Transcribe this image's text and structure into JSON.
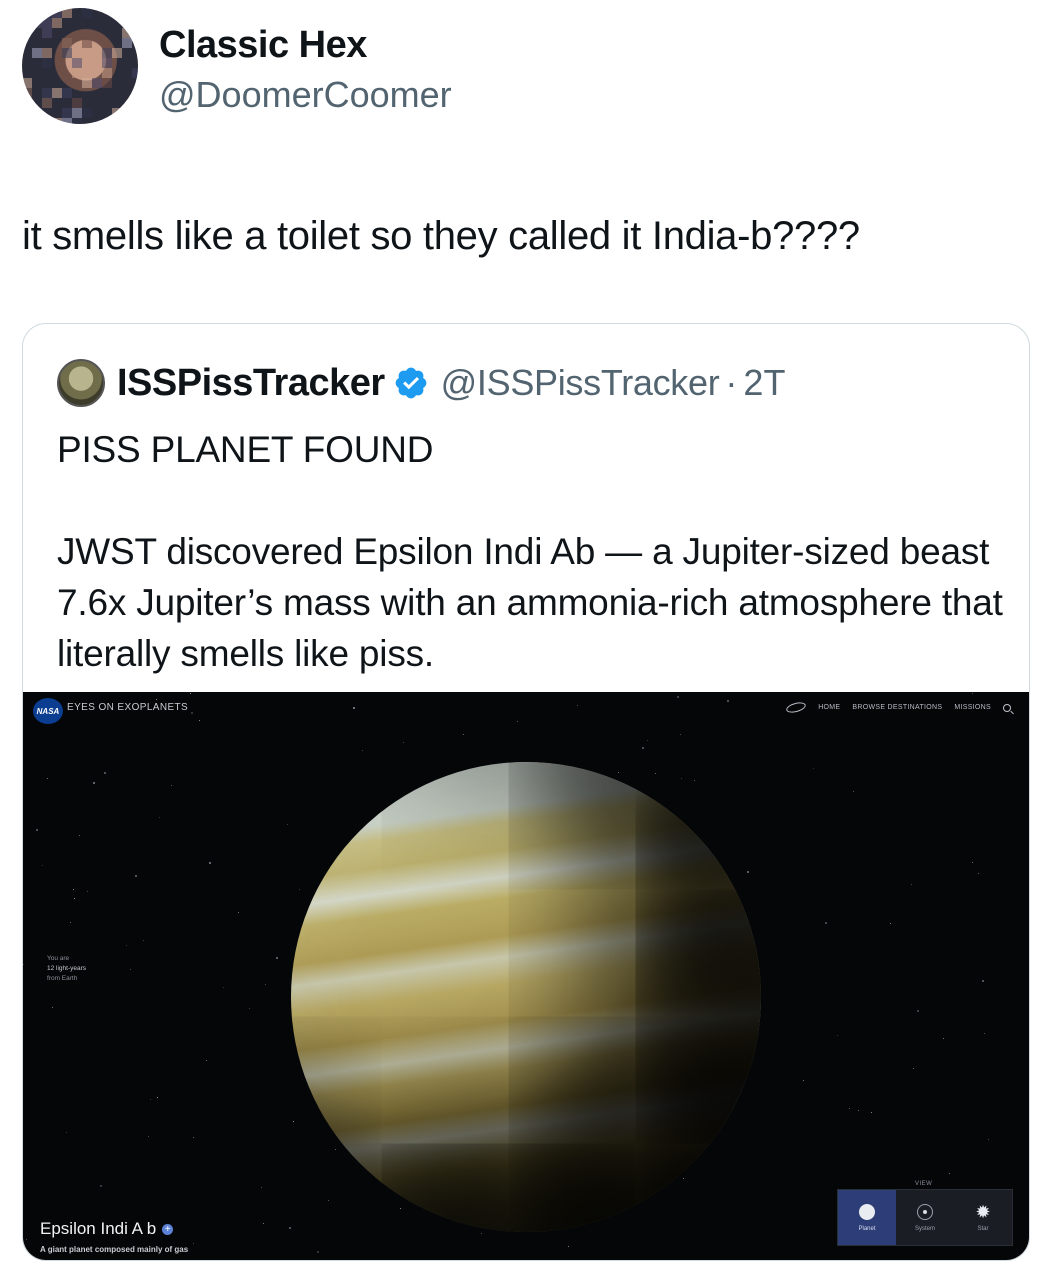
{
  "author": {
    "name": "Classic Hex",
    "handle": "@DoomerCoomer"
  },
  "tweet": {
    "text": "it smells like a toilet so they called it India-b????"
  },
  "quoted_tweet": {
    "name": "ISSPissTracker",
    "handle": "@ISSPissTracker",
    "separator": "·",
    "time": "2T",
    "verified": true,
    "verified_color": "#1d9bf0",
    "avatar_text": "ISSPissTracker",
    "paragraphs": [
      "PISS PLANET FOUND",
      "JWST discovered Epsilon Indi Ab — a Jupiter-sized beast 7.6x Jupiter’s mass with an ammonia-rich atmosphere that literally smells like piss."
    ]
  },
  "media": {
    "app_title": "EYES ON EXOPLANETS",
    "nasa_logo_text": "NASA",
    "nav": {
      "home": "HOME",
      "browse": "BROWSE DESTINATIONS",
      "missions": "MISSIONS",
      "search_icon": "search-icon"
    },
    "distance": {
      "line1": "You are",
      "line2": "12 light-years",
      "line3": "from Earth"
    },
    "planet_name": "Epsilon Indi A b",
    "planet_description": "A giant planet composed mainly of gas",
    "view": {
      "label": "VIEW",
      "options": [
        {
          "label": "Planet",
          "icon": "planet-icon",
          "active": true
        },
        {
          "label": "System",
          "icon": "system-icon",
          "active": false
        },
        {
          "label": "Star",
          "icon": "star-icon",
          "active": false
        }
      ]
    }
  }
}
